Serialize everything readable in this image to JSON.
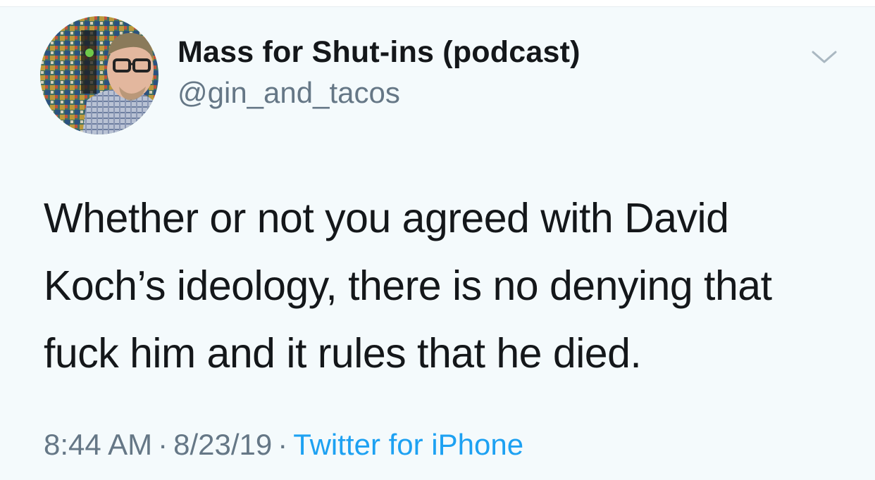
{
  "author": {
    "display_name": "Mass for Shut-ins (podcast)",
    "handle": "@gin_and_tacos",
    "avatar_icon": "profile-photo"
  },
  "tweet": {
    "text_lines": [
      "Whether or not you agreed with David",
      "Koch’s ideology, there is no denying that",
      "fuck him and it rules that he died."
    ]
  },
  "meta": {
    "time": "8:44 AM",
    "separator": "·",
    "date": "8/23/19",
    "source": "Twitter for iPhone"
  },
  "menu": {
    "icon": "chevron-down-icon"
  },
  "colors": {
    "background": "#f4fafc",
    "text": "#14171a",
    "secondary": "#657786",
    "link": "#1da1f2"
  }
}
